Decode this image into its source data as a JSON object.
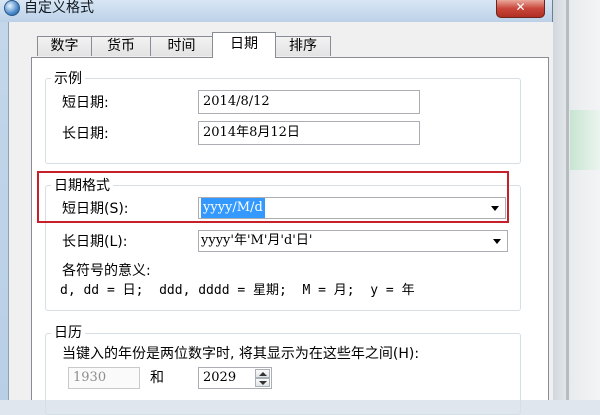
{
  "window": {
    "title": "自定义格式",
    "close_label": "✕"
  },
  "tabs": [
    {
      "label": "数字"
    },
    {
      "label": "货币"
    },
    {
      "label": "时间"
    },
    {
      "label": "日期"
    },
    {
      "label": "排序"
    }
  ],
  "example": {
    "title": "示例",
    "short_label": "短日期:",
    "short_value": "2014/8/12",
    "long_label": "长日期:",
    "long_value": "2014年8月12日"
  },
  "date_format": {
    "title": "日期格式",
    "short_label": "短日期(S):",
    "short_value": "yyyy/M/d",
    "long_label": "长日期(L):",
    "long_value": "yyyy'年'M'月'd'日'",
    "legend_title": "各符号的意义:",
    "legend_text": "d, dd = 日;  ddd, dddd = 星期;  M = 月;  y = 年"
  },
  "calendar": {
    "title": "日历",
    "two_digit_text": "当键入的年份是两位数字时, 将其显示为在这些年之间(H):",
    "from_year": "1930",
    "and_label": "和",
    "to_year": "2029"
  },
  "colors": {
    "highlight_border": "#c8202a",
    "selection": "#3399ff"
  }
}
